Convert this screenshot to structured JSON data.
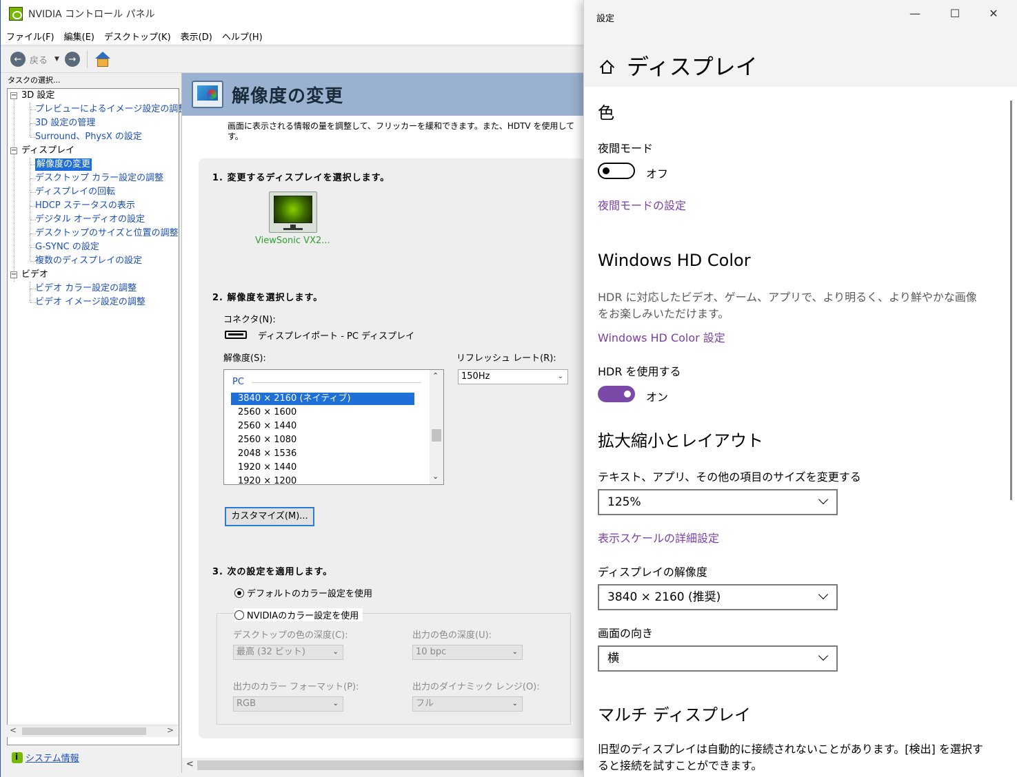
{
  "nvidia": {
    "title": "NVIDIA コントロール パネル",
    "menu": [
      "ファイル(F)",
      "編集(E)",
      "デスクトップ(K)",
      "表示(D)",
      "ヘルプ(H)"
    ],
    "toolbar": {
      "back_label": "戻る"
    },
    "task_label": "タスクの選択...",
    "tree": {
      "cat_3d": "3D 設定",
      "items_3d": [
        "プレビューによるイメージ設定の調整",
        "3D 設定の管理",
        "Surround、PhysX の設定"
      ],
      "cat_display": "ディスプレイ",
      "items_display": [
        "解像度の変更",
        "デスクトップ カラー設定の調整",
        "ディスプレイの回転",
        "HDCP ステータスの表示",
        "デジタル オーディオの設定",
        "デスクトップのサイズと位置の調整",
        "G-SYNC の設定",
        "複数のディスプレイの設定"
      ],
      "cat_video": "ビデオ",
      "items_video": [
        "ビデオ カラー設定の調整",
        "ビデオ イメージ設定の調整"
      ]
    },
    "system_info": "システム情報",
    "page": {
      "title": "解像度の変更",
      "description": "画面に表示される情報の量を調整して、フリッカーを緩和できます。また、HDTV を使用して",
      "description2": "す。",
      "step1": "1. 変更するディスプレイを選択します。",
      "monitor_name": "ViewSonic VX2...",
      "step2": "2. 解像度を選択します。",
      "connector_label": "コネクタ(N):",
      "connector_value": "ディスプレイポート - PC ディスプレイ",
      "resolution_label": "解像度(S):",
      "refresh_label": "リフレッシュ レート(R):",
      "refresh_value": "150Hz",
      "res_group": "PC",
      "resolutions": [
        "3840 × 2160 (ネイティブ)",
        "2560 × 1600",
        "2560 × 1440",
        "2560 × 1080",
        "2048 × 1536",
        "1920 × 1440",
        "1920 × 1200"
      ],
      "customize_button": "カスタマイズ(M)...",
      "step3": "3. 次の設定を適用します。",
      "radio_default": "デフォルトのカラー設定を使用",
      "radio_nvidia": "NVIDIAのカラー設定を使用",
      "desktop_depth_label": "デスクトップの色の深度(C):",
      "desktop_depth_value": "最高 (32 ビット)",
      "output_depth_label": "出力の色の深度(U):",
      "output_depth_value": "10 bpc",
      "color_format_label": "出力のカラー フォーマット(P):",
      "color_format_value": "RGB",
      "dynamic_range_label": "出力のダイナミック レンジ(O):",
      "dynamic_range_value": "フル"
    }
  },
  "settings": {
    "window_title": "設定",
    "page_title": "ディスプレイ",
    "color_heading": "色",
    "night_mode_label": "夜間モード",
    "night_mode_state": "オフ",
    "night_mode_link": "夜間モードの設定",
    "hd_color_heading": "Windows HD Color",
    "hd_color_desc": "HDR に対応したビデオ、ゲーム、アプリで、より明るく、より鮮やかな画像をお楽しみいただけます。",
    "hd_color_link": "Windows HD Color 設定",
    "hdr_label": "HDR を使用する",
    "hdr_state": "オン",
    "scale_heading": "拡大縮小とレイアウト",
    "scale_label": "テキスト、アプリ、その他の項目のサイズを変更する",
    "scale_value": "125%",
    "scale_link": "表示スケールの詳細設定",
    "resolution_label": "ディスプレイの解像度",
    "resolution_value": "3840 × 2160 (推奨)",
    "orientation_label": "画面の向き",
    "orientation_value": "横",
    "multi_heading": "マルチ ディスプレイ",
    "multi_desc": "旧型のディスプレイは自動的に接続されないことがあります。[検出] を選択すると接続を試すことができます。",
    "toggles": {
      "night_mode_on": false,
      "hdr_on": true
    },
    "accent_color": "#7b4aa8"
  }
}
